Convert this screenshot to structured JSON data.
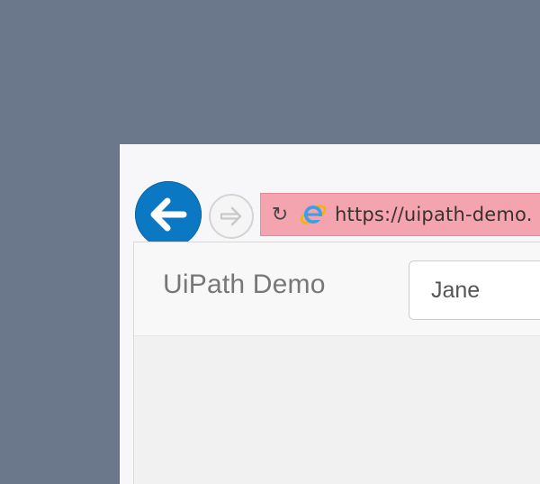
{
  "browser": {
    "address_url": "https://uipath-demo.",
    "icons": {
      "back": "back-arrow-icon",
      "forward": "forward-arrow-icon",
      "refresh": "refresh-icon",
      "site": "internet-explorer-icon"
    }
  },
  "page": {
    "brand": "UiPath Demo",
    "user_input_value": "Jane"
  },
  "colors": {
    "desktop_background": "#6b778a",
    "back_button": "#0b78c4",
    "address_highlight": "#f4a4ae"
  }
}
